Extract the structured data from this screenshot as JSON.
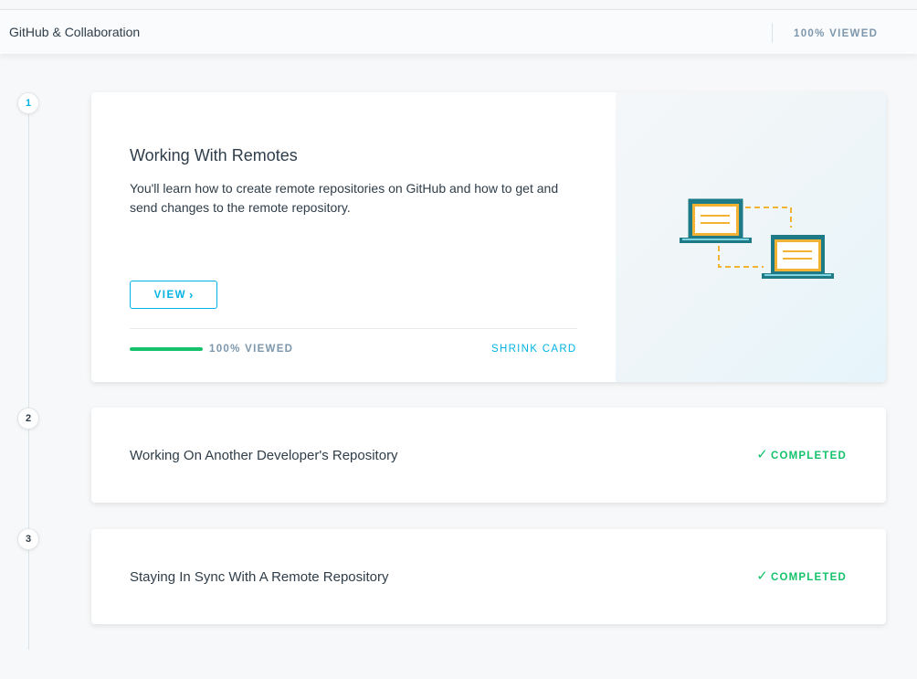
{
  "header": {
    "title": "GitHub & Collaboration",
    "viewed_label": "100% VIEWED"
  },
  "lessons": [
    {
      "number": "1",
      "title": "Working With Remotes",
      "description": "You'll learn how to create remote repositories on GitHub and how to get and send changes to the remote repository.",
      "view_label": "VIEW",
      "view_icon": "chevron-right-icon",
      "progress_percent": 100,
      "viewed_label": "100% VIEWED",
      "shrink_label": "SHRINK CARD",
      "illustration": "laptops-syncing-icon"
    },
    {
      "number": "2",
      "title": "Working On Another Developer's Repository",
      "status": "COMPLETED",
      "status_icon": "check-icon"
    },
    {
      "number": "3",
      "title": "Staying In Sync With A Remote Repository",
      "status": "COMPLETED",
      "status_icon": "check-icon"
    }
  ],
  "colors": {
    "accent": "#02b3e4",
    "success": "#15c26b",
    "muted": "#7d97ad",
    "text": "#2e3d49",
    "illustration_teal": "#1f7a87",
    "illustration_orange": "#f2b233"
  }
}
